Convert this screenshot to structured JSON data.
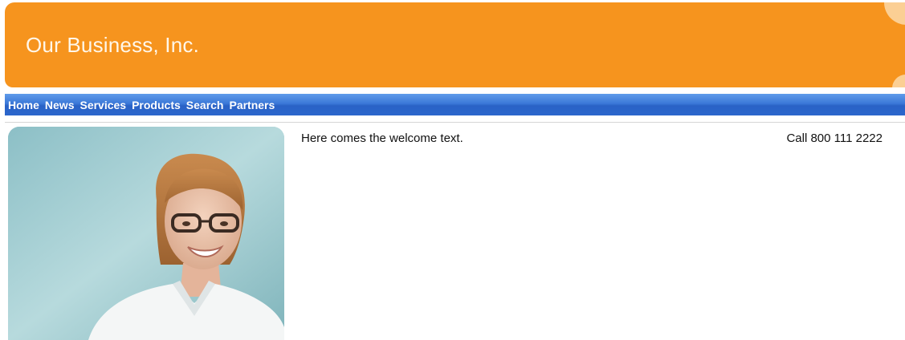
{
  "header": {
    "title": "Our Business, Inc.",
    "brand_color": "#f6941e"
  },
  "nav": {
    "accent_color": "#3b78d8",
    "items": [
      {
        "label": "Home"
      },
      {
        "label": "News"
      },
      {
        "label": "Services"
      },
      {
        "label": "Products"
      },
      {
        "label": "Search"
      },
      {
        "label": "Partners"
      }
    ]
  },
  "main": {
    "photo_icon": "smiling-woman-photo",
    "welcome_text": "Here comes the welcome text.",
    "phone_text": "Call 800 111 2222"
  }
}
